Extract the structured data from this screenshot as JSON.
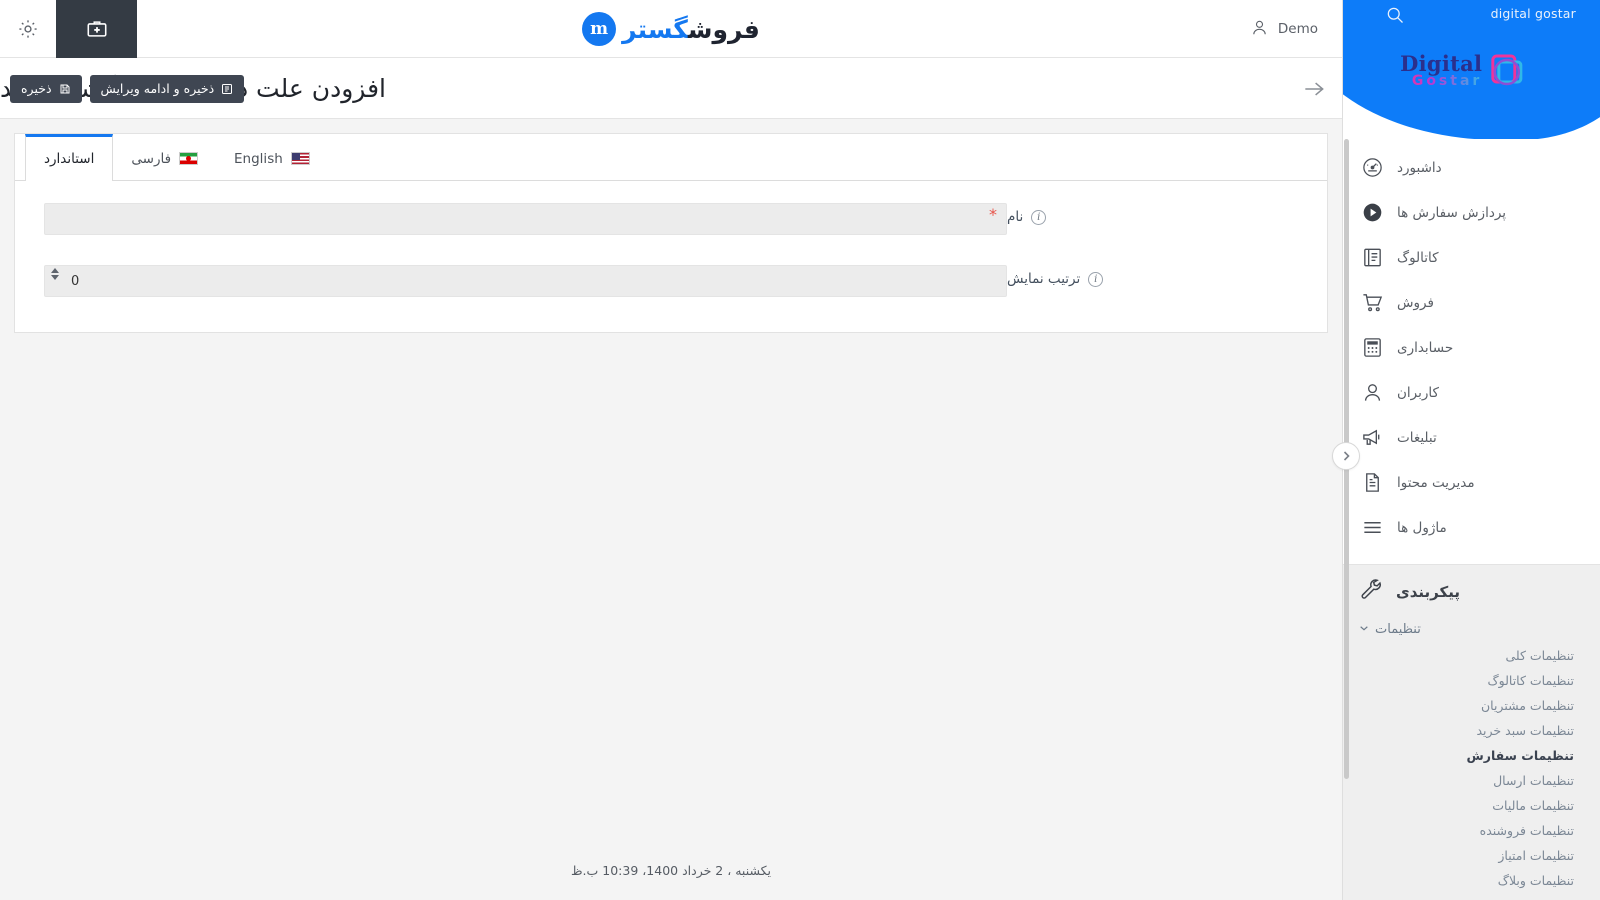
{
  "topbar": {
    "kit_icon": "first-aid-kit-icon",
    "gear_icon": "gear-icon",
    "logo_part_a": "گستر",
    "logo_part_b": "فروش",
    "logo_mark_letter": "m",
    "user_name": "Demo",
    "user_icon": "user-icon"
  },
  "titlebar": {
    "title": "افزودن علت درخواست برگشت جدید",
    "back_icon": "arrow-back-icon",
    "buttons": [
      {
        "label": "ذخیره",
        "icon": "save-icon",
        "name": "save-button"
      },
      {
        "label": "ذخیره و ادامه ویرایش",
        "icon": "save-continue-icon",
        "name": "save-and-continue-button"
      }
    ]
  },
  "tabs": [
    {
      "label": "استاندارد",
      "flag": "",
      "active": true
    },
    {
      "label": "فارسی",
      "flag": "ir",
      "active": false
    },
    {
      "label": "English",
      "flag": "us",
      "active": false
    }
  ],
  "form": {
    "fields": [
      {
        "label": "نام",
        "value": "",
        "placeholder": "",
        "required": true,
        "type": "text"
      },
      {
        "label": "ترتیب نمایش",
        "value": "0",
        "placeholder": "",
        "required": false,
        "type": "number"
      }
    ]
  },
  "footer": {
    "datetime": "یکشنبه ، 2 خرداد 1400، 10:39 ب.ظ"
  },
  "sidebar": {
    "brand": "digital gostar",
    "search_icon": "search-icon",
    "logo_title": "Digital",
    "logo_subtitle": "Gostar",
    "collapse_icon": "chevron-right-icon",
    "menu": [
      {
        "label": "داشبورد",
        "icon": "dashboard-gauge-icon"
      },
      {
        "label": "پردازش سفارش ها",
        "icon": "play-circle-icon"
      },
      {
        "label": "کاتالوگ",
        "icon": "book-icon"
      },
      {
        "label": "فروش",
        "icon": "shopping-cart-icon"
      },
      {
        "label": "حسابداری",
        "icon": "calculator-icon"
      },
      {
        "label": "کاربران",
        "icon": "user-icon"
      },
      {
        "label": "تبلیغات",
        "icon": "megaphone-icon"
      },
      {
        "label": "مدیریت محتوا",
        "icon": "document-icon"
      },
      {
        "label": "ماژول ها",
        "icon": "hamburger-lines-icon"
      }
    ],
    "config": {
      "label": "پیکربندی",
      "icon": "wrench-icon"
    },
    "submenu_head": {
      "label": "تنظیمات",
      "icon": "chevron-down-icon"
    },
    "submenu": [
      {
        "label": "تنظیمات کلی",
        "active": false
      },
      {
        "label": "تنظیمات کاتالوگ",
        "active": false
      },
      {
        "label": "تنظیمات مشتریان",
        "active": false
      },
      {
        "label": "تنظیمات سبد خرید",
        "active": false
      },
      {
        "label": "تنظیمات سفارش",
        "active": true
      },
      {
        "label": "تنظیمات ارسال",
        "active": false
      },
      {
        "label": "تنظیمات مالیات",
        "active": false
      },
      {
        "label": "تنظیمات فروشنده",
        "active": false
      },
      {
        "label": "تنظیمات امتیاز",
        "active": false
      },
      {
        "label": "تنظیمات وبلاگ",
        "active": false
      }
    ]
  },
  "colors": {
    "accent_blue": "#1478f0",
    "sidebar_blue": "#0d7cf9",
    "dark_button": "#3f4652",
    "required_red": "#e8544a",
    "panel_bg": "#f4f4f4"
  }
}
